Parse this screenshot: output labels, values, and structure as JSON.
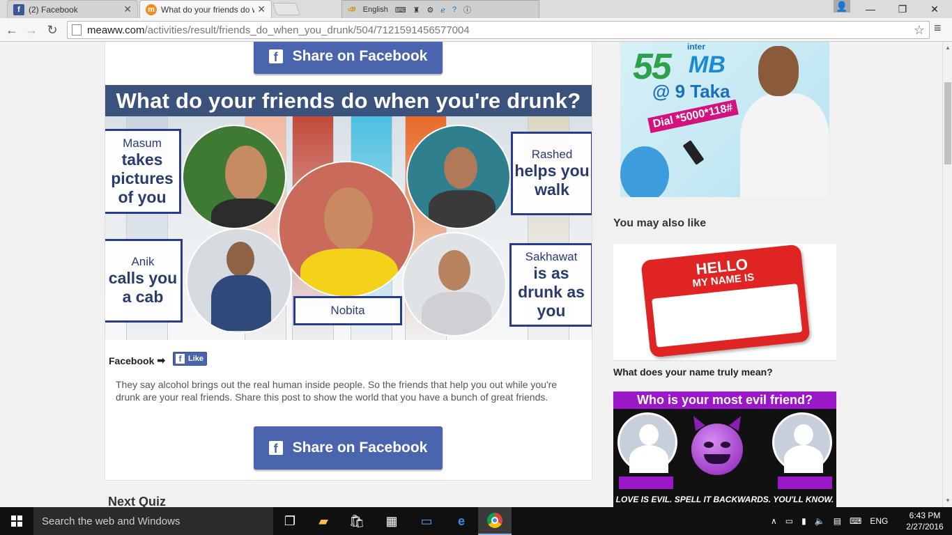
{
  "browser": {
    "tabs": [
      {
        "title": "(2) Facebook",
        "icon": "facebook-icon"
      },
      {
        "title": "What do your friends do w",
        "icon": "meaww-icon"
      }
    ],
    "ime_language": "English",
    "url_host": "meaww.com",
    "url_path": "/activities/result/friends_do_when_you_drunk/504/7121591456577004"
  },
  "page": {
    "share_label": "Share on Facebook",
    "quiz_heading": "What do your friends do when you're drunk?",
    "friends": [
      {
        "name": "Masum",
        "action": "takes pictures of you"
      },
      {
        "name": "Rashed",
        "action": "helps you walk"
      },
      {
        "name": "Anik",
        "action": "calls you a cab"
      },
      {
        "name": "Nobita",
        "action": ""
      },
      {
        "name": "Sakhawat",
        "action": "is as drunk as you"
      }
    ],
    "facebook_label": "Facebook",
    "arrow": "➡",
    "like_label": "Like",
    "description": "They say alcohol brings out the real human inside people. So the friends that help you out while you're drunk are your real friends. Share this post to show the world that you have a bunch of great friends.",
    "next_quiz": "Next Quiz"
  },
  "sidebar": {
    "ad": {
      "amount": "55",
      "unit": "MB",
      "price": "@ 9 Taka",
      "dial": "Dial *5000*118#",
      "inter": "inter"
    },
    "section_title": "You may also like",
    "recommendations": [
      {
        "caption": "What does your name truly mean?",
        "badge_line1": "HELLO",
        "badge_line2": "MY NAME IS"
      },
      {
        "caption": "",
        "banner": "Who is your most evil friend?",
        "footer": "LOVE IS EVIL. SPELL IT BACKWARDS. YOU'LL KNOW."
      }
    ]
  },
  "taskbar": {
    "search_placeholder": "Search the web and Windows",
    "language": "ENG",
    "time": "6:43 PM",
    "date": "2/27/2016"
  },
  "colors": {
    "facebook_blue": "#4a65ad",
    "quiz_header": "#3b527d",
    "name_box_border": "#2a3b8a",
    "evil_purple": "#9a18c8"
  }
}
